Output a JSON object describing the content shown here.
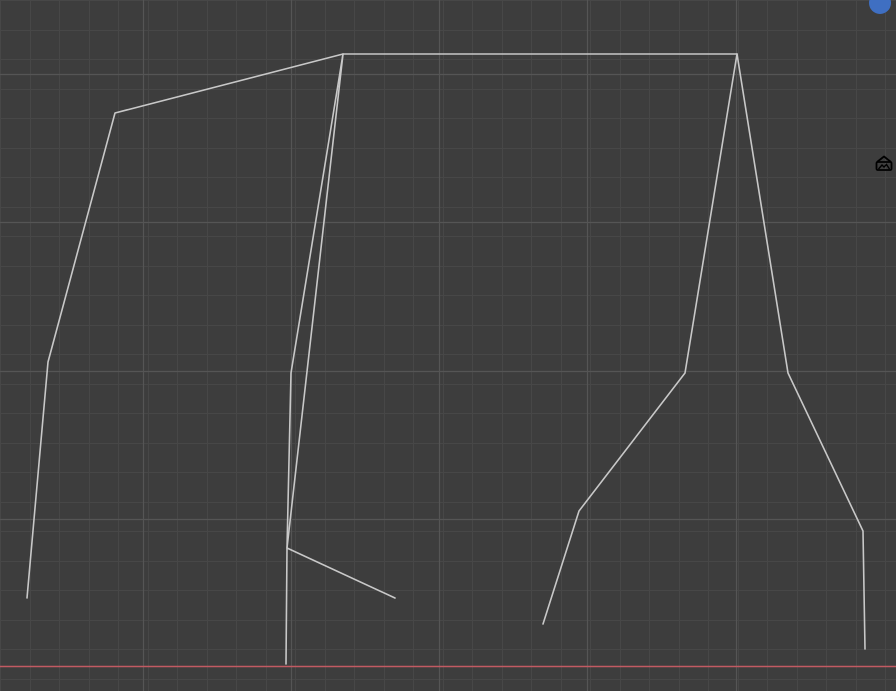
{
  "viewport": {
    "background_color": "#3d3d3d",
    "grid_minor_color": "#474747",
    "grid_major_color": "#555555",
    "x_axis_color": "#c25a62",
    "armature_color": "#c8c8c8"
  },
  "gizmo": {
    "axis_ball_color": "#3f6fc2",
    "axis_ball_icon": "navigation-axis-ball-icon"
  },
  "camera_toggle": {
    "icon": "camera-icon",
    "color": "#000000"
  }
}
